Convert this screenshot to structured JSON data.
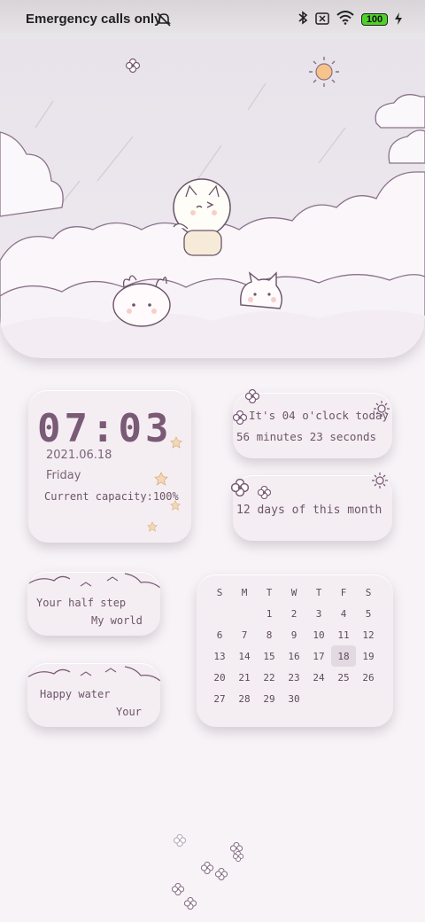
{
  "status_bar": {
    "network_text": "Emergency calls only",
    "battery_level": "100",
    "icons": [
      "mute-icon",
      "bluetooth-icon",
      "no-sim-icon",
      "wifi-icon",
      "battery-icon",
      "charging-icon"
    ]
  },
  "clock_widget": {
    "time": "07:03",
    "date": "2021.06.18",
    "weekday": "Friday",
    "capacity_text": "Current capacity:100%"
  },
  "time_widget": {
    "line1": "It's 04 o'clock today",
    "line2": "56 minutes 23 seconds"
  },
  "month_widget": {
    "text": "12 days of this month"
  },
  "quote_widget_1": {
    "line1": "Your half step",
    "line2": "My world"
  },
  "quote_widget_2": {
    "line1": "Happy water",
    "line2": "Your"
  },
  "calendar": {
    "weekdays": [
      "S",
      "M",
      "T",
      "W",
      "T",
      "F",
      "S"
    ],
    "weeks": [
      [
        "",
        "",
        "1",
        "2",
        "3",
        "4",
        "5"
      ],
      [
        "6",
        "7",
        "8",
        "9",
        "10",
        "11",
        "12"
      ],
      [
        "13",
        "14",
        "15",
        "16",
        "17",
        "18",
        "19"
      ],
      [
        "20",
        "21",
        "22",
        "23",
        "24",
        "25",
        "26"
      ],
      [
        "27",
        "28",
        "29",
        "30",
        "",
        "",
        ""
      ]
    ],
    "today": "18"
  },
  "colors": {
    "accent": "#7a5a76",
    "card_bg": "#f4eef3",
    "battery_green": "#4fd12a",
    "sun": "#f5c48a"
  }
}
